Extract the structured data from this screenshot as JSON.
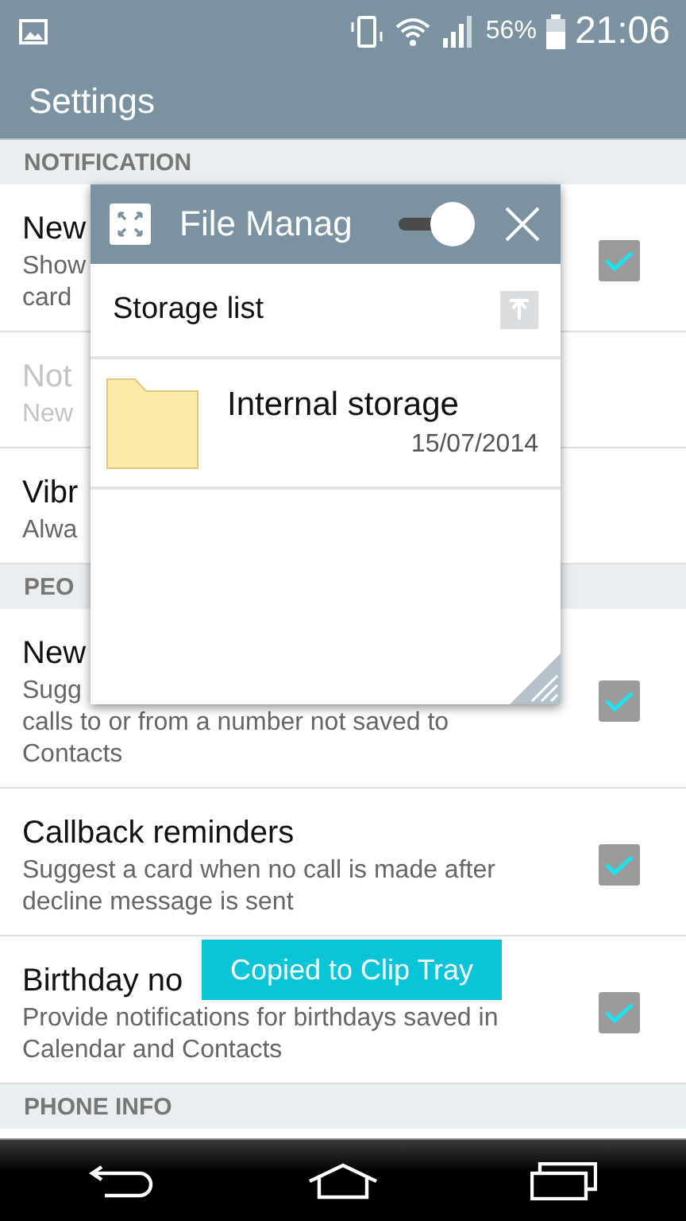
{
  "status_bar": {
    "battery_text": "56%",
    "time": "21:06"
  },
  "app_bar": {
    "title": "Settings"
  },
  "sections": [
    {
      "header": "NOTIFICATION",
      "rows": [
        {
          "kind": "checkbox",
          "title": "New",
          "subtitle_lines": [
            "Show",
            "card"
          ],
          "disabled": false,
          "checked": true
        },
        {
          "kind": "plain",
          "title": "Not",
          "subtitle_lines": [
            "New"
          ],
          "disabled": true
        },
        {
          "kind": "plain",
          "title": "Vibr",
          "subtitle_lines": [
            "Alwa"
          ],
          "disabled": false
        }
      ]
    },
    {
      "header": "PEO",
      "rows": [
        {
          "kind": "checkbox",
          "title": "New",
          "subtitle_lines": [
            "Sugg",
            "calls to or from a number not saved to",
            "Contacts"
          ],
          "disabled": false,
          "checked": true
        },
        {
          "kind": "checkbox",
          "title": "Callback reminders",
          "subtitle_lines": [
            "Suggest a card when no call is made after",
            "decline message is sent"
          ],
          "disabled": false,
          "checked": true
        },
        {
          "kind": "checkbox",
          "title": "Birthday no",
          "subtitle_lines": [
            "Provide notifications for birthdays saved in",
            "Calendar and Contacts"
          ],
          "disabled": false,
          "checked": true
        }
      ]
    },
    {
      "header": "PHONE INFO"
    }
  ],
  "file_manager": {
    "title": "File Manag",
    "toggle_on": true,
    "location": "Storage list",
    "items": [
      {
        "name": "Internal storage",
        "date": "15/07/2014"
      }
    ]
  },
  "toast": {
    "text": "Copied to Clip Tray"
  }
}
